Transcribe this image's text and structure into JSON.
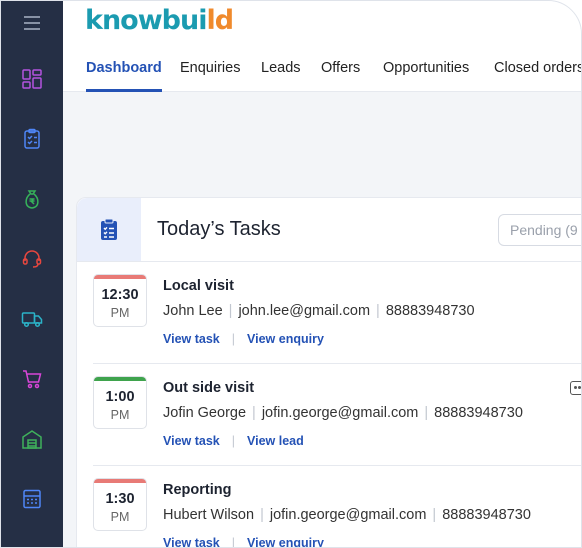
{
  "app": {
    "logo_main": "knowbui",
    "logo_accent": "ld"
  },
  "sidebar": {
    "items": [
      {
        "name": "dashboard",
        "icon": "grid-icon",
        "color": "#b453e0"
      },
      {
        "name": "enquiries",
        "icon": "clipboard-check-icon",
        "color": "#4f86f7"
      },
      {
        "name": "leads",
        "icon": "money-bag-rupee-icon",
        "color": "#36b25a"
      },
      {
        "name": "support",
        "icon": "headset-icon",
        "color": "#e8473f"
      },
      {
        "name": "delivery",
        "icon": "truck-icon",
        "color": "#2bb3c8"
      },
      {
        "name": "orders",
        "icon": "cart-icon",
        "color": "#d846d8"
      },
      {
        "name": "warehouse",
        "icon": "warehouse-icon",
        "color": "#3fb15b"
      },
      {
        "name": "reports",
        "icon": "calculator-icon",
        "color": "#4f86f7"
      }
    ]
  },
  "nav": {
    "tabs": [
      {
        "label": "Dashboard",
        "active": true
      },
      {
        "label": "Enquiries",
        "active": false
      },
      {
        "label": "Leads",
        "active": false
      },
      {
        "label": "Offers",
        "active": false
      },
      {
        "label": "Opportunities",
        "active": false
      },
      {
        "label": "Closed orders",
        "active": false
      }
    ]
  },
  "tasks_card": {
    "title": "Today’s Tasks",
    "filter_value": "Pending (9",
    "tasks": [
      {
        "time": "12:30",
        "ampm": "PM",
        "accent": "#e87a76",
        "title": "Local visit",
        "person": "John Lee",
        "email": "john.lee@gmail.com",
        "phone": "88883948730",
        "link1": "View task",
        "link2": "View enquiry"
      },
      {
        "time": "1:00",
        "ampm": "PM",
        "accent": "#3fa34d",
        "title": "Out side visit",
        "person": "Jofin George",
        "email": "jofin.george@gmail.com",
        "phone": "88883948730",
        "link1": "View task",
        "link2": "View lead"
      },
      {
        "time": "1:30",
        "ampm": "PM",
        "accent": "#e87a76",
        "title": "Reporting",
        "person": "Hubert Wilson",
        "email": "jofin.george@gmail.com",
        "phone": "88883948730",
        "link1": "View task",
        "link2": "View enquiry"
      }
    ]
  }
}
